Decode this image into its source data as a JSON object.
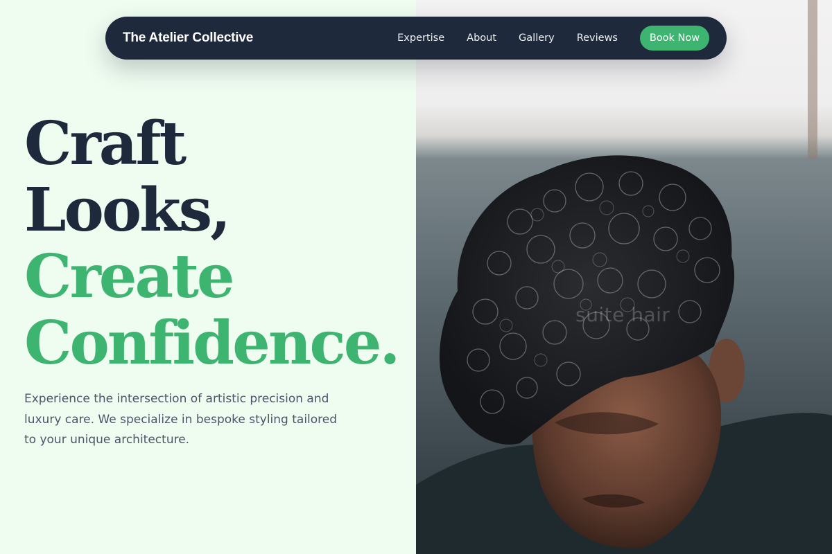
{
  "nav": {
    "brand": "The Atelier Collective",
    "links": [
      "Expertise",
      "About",
      "Gallery",
      "Reviews"
    ],
    "cta": "Book Now"
  },
  "hero": {
    "headline_dark": [
      "Craft",
      "Looks,"
    ],
    "headline_green": [
      "Create",
      "Confidence."
    ],
    "description": "Experience the intersection of artistic precision and luxury care. We specialize in bespoke styling tailored to your unique architecture.",
    "image_watermark": "suite hair"
  },
  "colors": {
    "background": "#effdf1",
    "navy": "#1e293b",
    "accent_green": "#3db46f",
    "body_text": "#4a5568"
  }
}
